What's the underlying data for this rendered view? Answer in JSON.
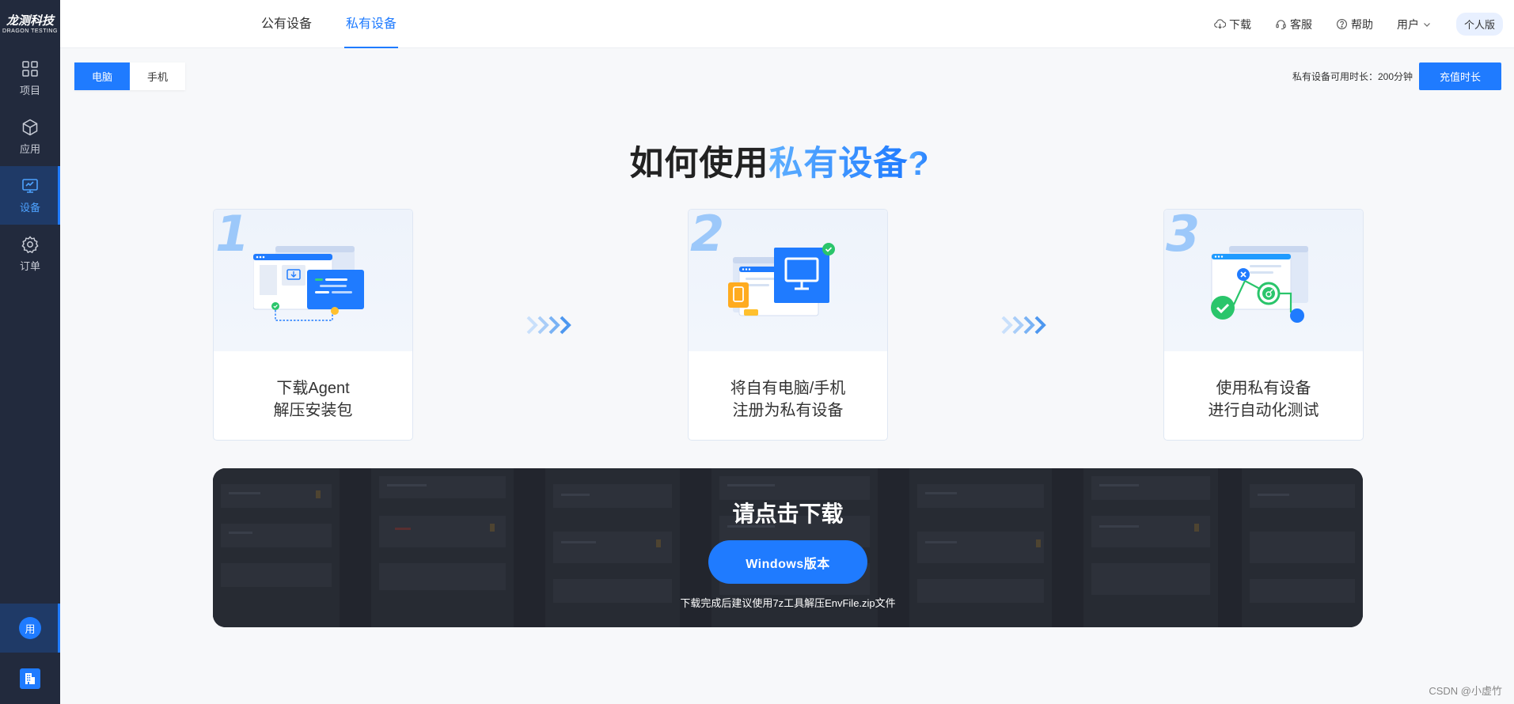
{
  "brand": {
    "name_cn": "龙测科技",
    "name_en": "DRAGON TESTING"
  },
  "sidebar": {
    "items": [
      {
        "label": "项目",
        "icon": "grid-icon",
        "active": false
      },
      {
        "label": "应用",
        "icon": "cube-icon",
        "active": false
      },
      {
        "label": "设备",
        "icon": "monitor-icon",
        "active": true
      },
      {
        "label": "订单",
        "icon": "gear-icon",
        "active": false
      }
    ],
    "user_avatar": "用",
    "org_icon": "building-icon"
  },
  "header": {
    "tabs": [
      {
        "label": "公有设备",
        "active": false
      },
      {
        "label": "私有设备",
        "active": true
      }
    ],
    "download_label": "下载",
    "service_label": "客服",
    "help_label": "帮助",
    "user_label": "用户",
    "edition_label": "个人版"
  },
  "toolbar": {
    "segments": [
      {
        "label": "电脑",
        "active": true
      },
      {
        "label": "手机",
        "active": false
      }
    ],
    "duration_text": "私有设备可用时长：200分钟",
    "recharge_label": "充值时长"
  },
  "heading": {
    "prefix": "如何使用",
    "highlight": "私有设备",
    "suffix": "?"
  },
  "steps": [
    {
      "num": "1",
      "line1": "下载Agent",
      "line2": "解压安装包"
    },
    {
      "num": "2",
      "line1": "将自有电脑/手机",
      "line2": "注册为私有设备"
    },
    {
      "num": "3",
      "line1": "使用私有设备",
      "line2": "进行自动化测试"
    }
  ],
  "download": {
    "title": "请点击下载",
    "button_label": "Windows版本",
    "tip": "下载完成后建议使用7z工具解压EnvFile.zip文件"
  },
  "watermark": "CSDN @小虚竹",
  "colors": {
    "primary": "#1f7bff",
    "sidebar": "#222a3d",
    "success": "#2ac56b"
  }
}
